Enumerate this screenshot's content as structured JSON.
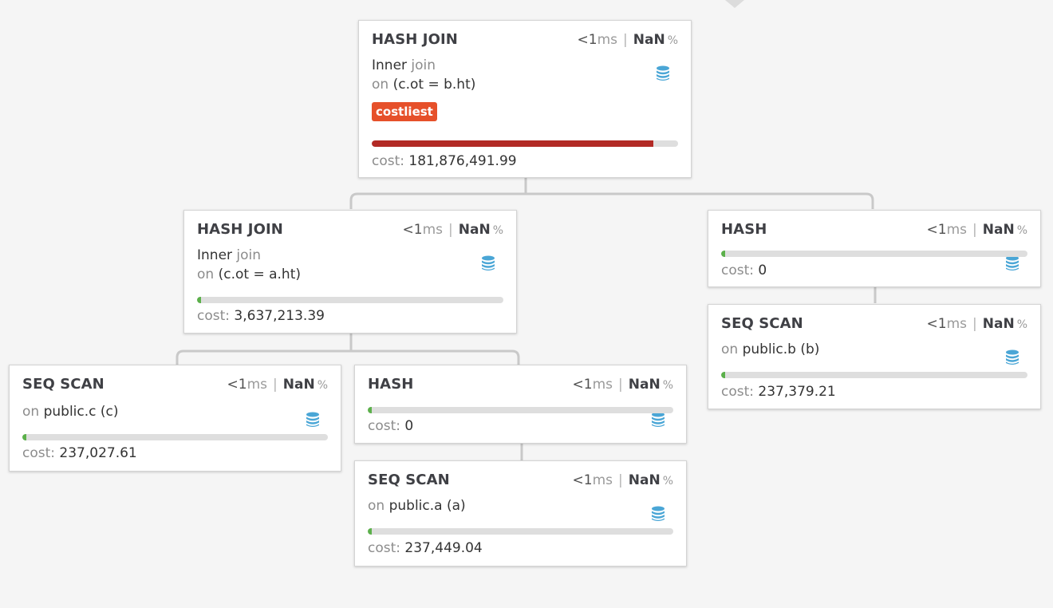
{
  "colors": {
    "costliest_bar": "#b22a25",
    "normal_bar": "#5bb04a",
    "badge": "#e6502a",
    "db_icon": "#4aa6d6"
  },
  "nodes": {
    "root": {
      "title": "HASH JOIN",
      "time_prefix": "<1",
      "time_unit": "ms",
      "percent": "NaN",
      "percent_symbol": "%",
      "join_type": "Inner",
      "join_word": "join",
      "on_label": "on",
      "condition": "(c.ot = b.ht)",
      "badge": "costliest",
      "cost_label": "cost:",
      "cost": "181,876,491.99",
      "bar_fraction": 0.92,
      "icon": "database-icon"
    },
    "left_join": {
      "title": "HASH JOIN",
      "time_prefix": "<1",
      "time_unit": "ms",
      "percent": "NaN",
      "percent_symbol": "%",
      "join_type": "Inner",
      "join_word": "join",
      "on_label": "on",
      "condition": "(c.ot = a.ht)",
      "cost_label": "cost:",
      "cost": "3,637,213.39",
      "bar_fraction": 0.013,
      "icon": "database-icon"
    },
    "right_hash": {
      "title": "HASH",
      "time_prefix": "<1",
      "time_unit": "ms",
      "percent": "NaN",
      "percent_symbol": "%",
      "cost_label": "cost:",
      "cost": "0",
      "bar_fraction": 0.005,
      "icon": "database-icon"
    },
    "seq_scan_b": {
      "title": "SEQ SCAN",
      "time_prefix": "<1",
      "time_unit": "ms",
      "percent": "NaN",
      "percent_symbol": "%",
      "on_label": "on",
      "relation": "public.b (b)",
      "cost_label": "cost:",
      "cost": "237,379.21",
      "bar_fraction": 0.005,
      "icon": "database-icon"
    },
    "seq_scan_c": {
      "title": "SEQ SCAN",
      "time_prefix": "<1",
      "time_unit": "ms",
      "percent": "NaN",
      "percent_symbol": "%",
      "on_label": "on",
      "relation": "public.c (c)",
      "cost_label": "cost:",
      "cost": "237,027.61",
      "bar_fraction": 0.005,
      "icon": "database-icon"
    },
    "left_hash": {
      "title": "HASH",
      "time_prefix": "<1",
      "time_unit": "ms",
      "percent": "NaN",
      "percent_symbol": "%",
      "cost_label": "cost:",
      "cost": "0",
      "bar_fraction": 0.005,
      "icon": "database-icon"
    },
    "seq_scan_a": {
      "title": "SEQ SCAN",
      "time_prefix": "<1",
      "time_unit": "ms",
      "percent": "NaN",
      "percent_symbol": "%",
      "on_label": "on",
      "relation": "public.a (a)",
      "cost_label": "cost:",
      "cost": "237,449.04",
      "bar_fraction": 0.005,
      "icon": "database-icon"
    }
  }
}
